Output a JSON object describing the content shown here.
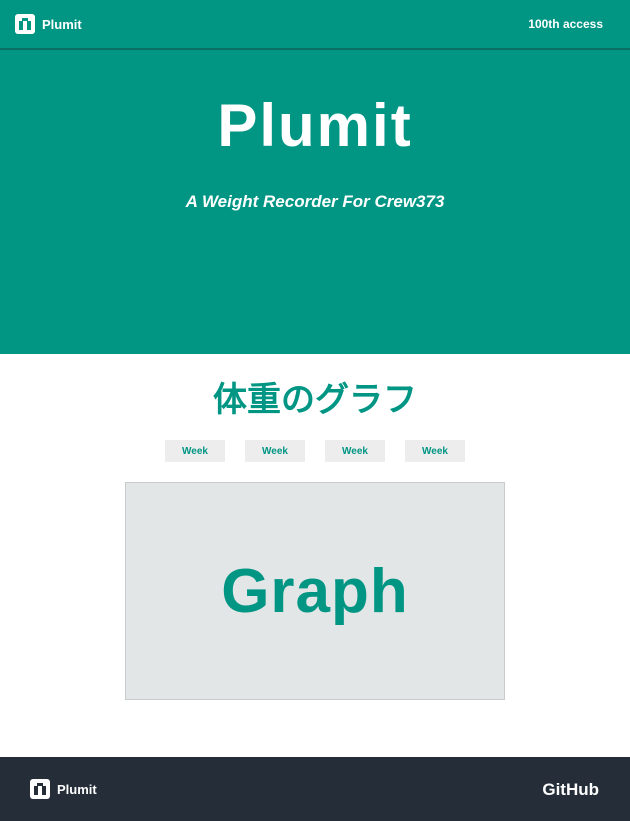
{
  "header": {
    "brand_label": "Plumit",
    "brand_icon": "scale-icon",
    "access_text": "100th access"
  },
  "hero": {
    "title": "Plumit",
    "subtitle": "A Weight Recorder For Crew373"
  },
  "main": {
    "section_title": "体重のグラフ",
    "tabs": [
      {
        "label": "Week"
      },
      {
        "label": "Week"
      },
      {
        "label": "Week"
      },
      {
        "label": "Week"
      }
    ],
    "graph_label": "Graph"
  },
  "footer": {
    "brand_label": "Plumit",
    "brand_icon": "scale-icon",
    "github_label": "GitHub"
  },
  "colors": {
    "primary": "#019584",
    "footer_bg": "#252e38",
    "graph_bg": "#e3e6e6",
    "tab_bg": "#ededed"
  }
}
